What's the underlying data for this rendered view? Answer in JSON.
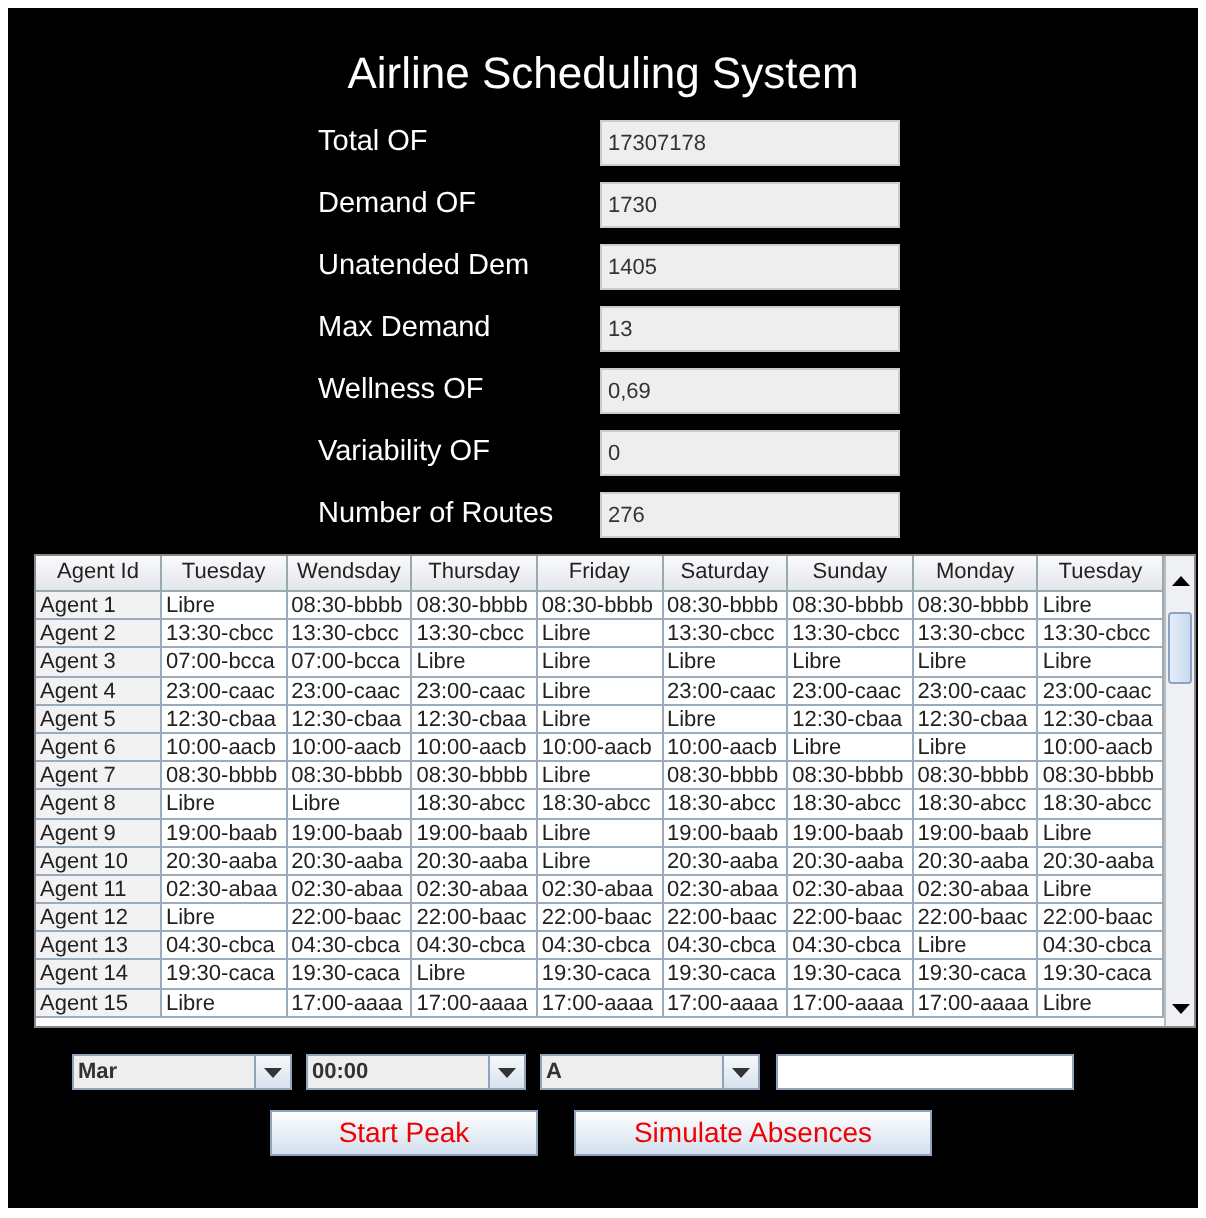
{
  "window": {
    "title": "Airline Scheduling System"
  },
  "metrics": [
    {
      "label": "Total OF",
      "value": "17307178"
    },
    {
      "label": "Demand OF",
      "value": "1730"
    },
    {
      "label": "Unatended Dem",
      "value": "1405"
    },
    {
      "label": "Max Demand",
      "value": "13"
    },
    {
      "label": "Wellness OF",
      "value": "0,69"
    },
    {
      "label": "Variability OF",
      "value": "0"
    },
    {
      "label": "Number of Routes",
      "value": "276"
    }
  ],
  "table": {
    "columns": [
      "Agent Id",
      "Tuesday",
      "Wendsday",
      "Thursday",
      "Friday",
      "Saturday",
      "Sunday",
      "Monday",
      "Tuesday"
    ],
    "rows": [
      [
        "Agent 1",
        "Libre",
        "08:30-bbbb",
        "08:30-bbbb",
        "08:30-bbbb",
        "08:30-bbbb",
        "08:30-bbbb",
        "08:30-bbbb",
        "Libre"
      ],
      [
        "Agent 2",
        "13:30-cbcc",
        "13:30-cbcc",
        "13:30-cbcc",
        "Libre",
        "13:30-cbcc",
        "13:30-cbcc",
        "13:30-cbcc",
        "13:30-cbcc"
      ],
      [
        "Agent 3",
        "07:00-bcca",
        "07:00-bcca",
        "Libre",
        "Libre",
        "Libre",
        "Libre",
        "Libre",
        "Libre"
      ],
      [
        "Agent 4",
        "23:00-caac",
        "23:00-caac",
        "23:00-caac",
        "Libre",
        "23:00-caac",
        "23:00-caac",
        "23:00-caac",
        "23:00-caac"
      ],
      [
        "Agent 5",
        "12:30-cbaa",
        "12:30-cbaa",
        "12:30-cbaa",
        "Libre",
        "Libre",
        "12:30-cbaa",
        "12:30-cbaa",
        "12:30-cbaa"
      ],
      [
        "Agent 6",
        "10:00-aacb",
        "10:00-aacb",
        "10:00-aacb",
        "10:00-aacb",
        "10:00-aacb",
        "Libre",
        "Libre",
        "10:00-aacb"
      ],
      [
        "Agent 7",
        "08:30-bbbb",
        "08:30-bbbb",
        "08:30-bbbb",
        "Libre",
        "08:30-bbbb",
        "08:30-bbbb",
        "08:30-bbbb",
        "08:30-bbbb"
      ],
      [
        "Agent 8",
        "Libre",
        "Libre",
        "18:30-abcc",
        "18:30-abcc",
        "18:30-abcc",
        "18:30-abcc",
        "18:30-abcc",
        "18:30-abcc"
      ],
      [
        "Agent 9",
        "19:00-baab",
        "19:00-baab",
        "19:00-baab",
        "Libre",
        "19:00-baab",
        "19:00-baab",
        "19:00-baab",
        "Libre"
      ],
      [
        "Agent 10",
        "20:30-aaba",
        "20:30-aaba",
        "20:30-aaba",
        "Libre",
        "20:30-aaba",
        "20:30-aaba",
        "20:30-aaba",
        "20:30-aaba"
      ],
      [
        "Agent 11",
        "02:30-abaa",
        "02:30-abaa",
        "02:30-abaa",
        "02:30-abaa",
        "02:30-abaa",
        "02:30-abaa",
        "02:30-abaa",
        "Libre"
      ],
      [
        "Agent 12",
        "Libre",
        "22:00-baac",
        "22:00-baac",
        "22:00-baac",
        "22:00-baac",
        "22:00-baac",
        "22:00-baac",
        "22:00-baac"
      ],
      [
        "Agent 13",
        "04:30-cbca",
        "04:30-cbca",
        "04:30-cbca",
        "04:30-cbca",
        "04:30-cbca",
        "04:30-cbca",
        "Libre",
        "04:30-cbca"
      ],
      [
        "Agent 14",
        "19:30-caca",
        "19:30-caca",
        "Libre",
        "19:30-caca",
        "19:30-caca",
        "19:30-caca",
        "19:30-caca",
        "19:30-caca"
      ],
      [
        "Agent 15",
        "Libre",
        "17:00-aaaa",
        "17:00-aaaa",
        "17:00-aaaa",
        "17:00-aaaa",
        "17:00-aaaa",
        "17:00-aaaa",
        "Libre"
      ]
    ]
  },
  "controls": {
    "combos": [
      "Mar",
      "00:00",
      "A"
    ],
    "buttons": [
      "Start Peak",
      "Simulate Absences"
    ]
  }
}
